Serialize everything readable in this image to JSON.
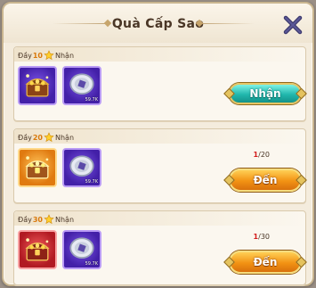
{
  "window": {
    "title": "Quà Cấp Sao"
  },
  "tiers": [
    {
      "prefix": "Đầy ",
      "stars": "10",
      "suffix": "Nhận",
      "chest_color": "purple",
      "items": [
        {
          "icon": "treasure-chest-icon",
          "qty": ""
        },
        {
          "icon": "silver-coin-icon",
          "qty": "59.7K"
        }
      ],
      "progress": {
        "current": "",
        "total": ""
      },
      "button_label": "Nhận",
      "button_type": "claim"
    },
    {
      "prefix": "Đầy ",
      "stars": "20",
      "suffix": "Nhận",
      "chest_color": "gold",
      "items": [
        {
          "icon": "treasure-chest-icon",
          "qty": ""
        },
        {
          "icon": "silver-coin-icon",
          "qty": "59.7K"
        }
      ],
      "progress": {
        "current": "1",
        "total": "/20"
      },
      "button_label": "Đến",
      "button_type": "go"
    },
    {
      "prefix": "Đầy ",
      "stars": "30",
      "suffix": "Nhận",
      "chest_color": "red",
      "items": [
        {
          "icon": "treasure-chest-icon",
          "qty": ""
        },
        {
          "icon": "silver-coin-icon",
          "qty": "59.7K"
        }
      ],
      "progress": {
        "current": "1",
        "total": "/30"
      },
      "button_label": "Đến",
      "button_type": "go"
    }
  ],
  "colors": {
    "claim_button": "#21b7ad",
    "go_button": "#f29213",
    "panel": "#f4ecdd",
    "progress_current": "#d41c1c"
  }
}
